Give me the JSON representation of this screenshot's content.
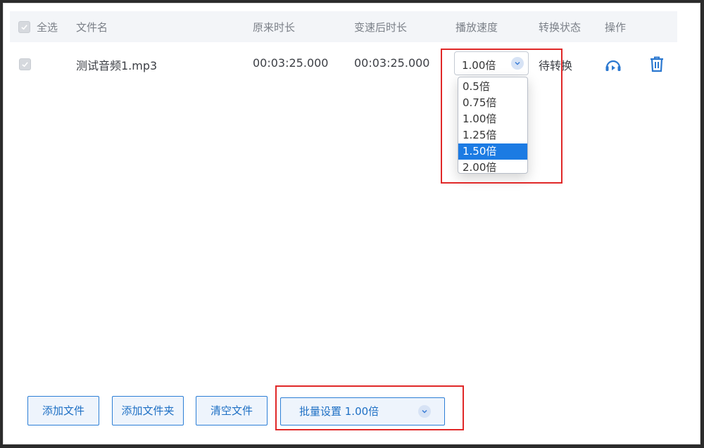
{
  "header": {
    "select_all": "全选",
    "filename": "文件名",
    "original_duration": "原来时长",
    "new_duration": "变速后时长",
    "speed": "播放速度",
    "status": "转换状态",
    "actions": "操作"
  },
  "row": {
    "checked": true,
    "filename": "测试音频1.mp3",
    "original_duration": "00:03:25.000",
    "new_duration": "00:03:25.000",
    "speed": "1.00倍",
    "status": "待转换",
    "actions": [
      "play-icon",
      "trash-icon"
    ]
  },
  "speed_options": [
    "0.5倍",
    "0.75倍",
    "1.00倍",
    "1.25倍",
    "1.50倍",
    "2.00倍"
  ],
  "highlighted_option": "1.50倍",
  "buttons": {
    "add_file": "添加文件",
    "add_folder": "添加文件夹",
    "clear_files": "清空文件"
  },
  "batch": {
    "label": "批量设置 1.00倍"
  },
  "colors": {
    "accent": "#1d6fc4",
    "highlight": "#1c7be3",
    "annotation": "#e02828"
  }
}
